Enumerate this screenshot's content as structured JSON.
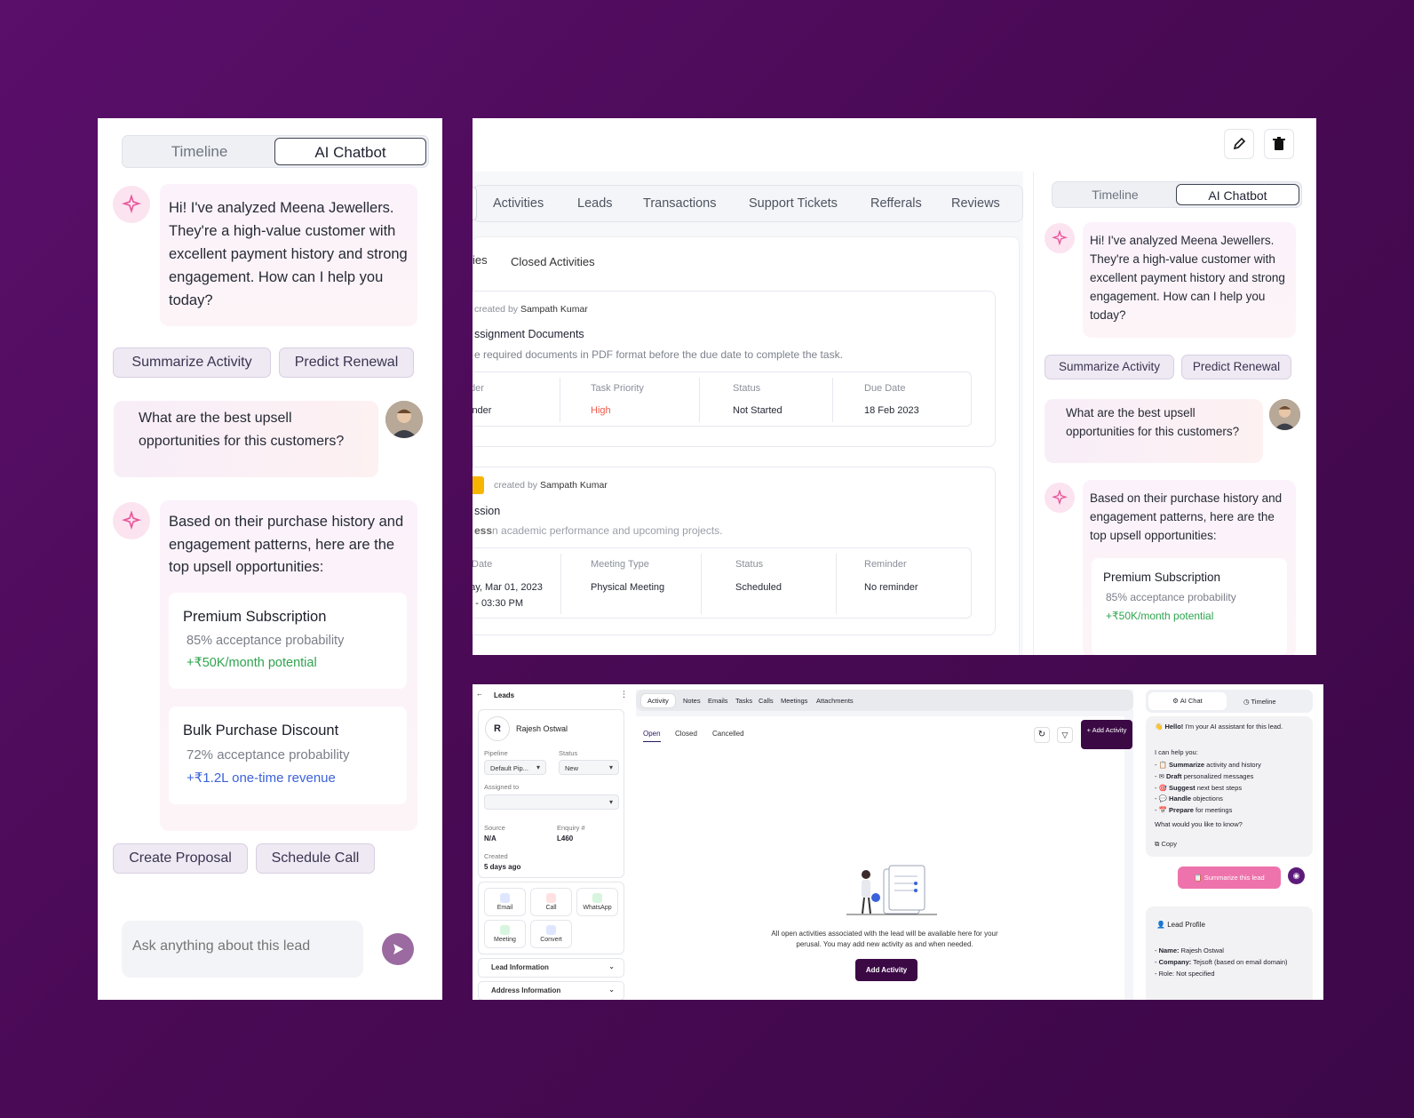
{
  "colors": {
    "background": "#4d0b5a",
    "accent_pink": "#e8559a",
    "accent_purple": "#3b0a45",
    "green": "#2ea44f",
    "blue": "#3b62d9",
    "high_red": "#f05a4b"
  },
  "chatbot": {
    "tabs": {
      "timeline": "Timeline",
      "ai_chatbot": "AI Chatbot"
    },
    "greeting": "Hi! I've analyzed Meena Jewellers. They're a high-value customer with excellent payment history and strong engagement. How can I help you today?",
    "suggestions": [
      "Summarize Activity",
      "Predict Renewal"
    ],
    "user_question": "What are the best upsell opportunities for this customers?",
    "answer_intro": "Based on their purchase history and engagement patterns, here are the top upsell opportunities:",
    "opportunities": [
      {
        "title": "Premium Subscription",
        "probability": "85% acceptance probability",
        "value": "+₹50K/month potential"
      },
      {
        "title": "Bulk Purchase Discount",
        "probability": "72% acceptance probability",
        "value": "+₹1.2L one-time revenue"
      }
    ],
    "actions": [
      "Create Proposal",
      "Schedule Call"
    ],
    "input_placeholder": "Ask anything about this lead"
  },
  "detail": {
    "tabs": [
      "Activities",
      "Leads",
      "Transactions",
      "Support Tickets",
      "Refferals",
      "Reviews"
    ],
    "subtabs": {
      "open_partial": "ies",
      "closed": "Closed Activities"
    },
    "activity1": {
      "created_by_prefix": "created by",
      "created_by": "Sampath Kumar",
      "title": "ssignment Documents",
      "desc": "e required documents in PDF format before the due date to complete the task.",
      "labels": [
        "der",
        "Task Priority",
        "Status",
        "Due Date"
      ],
      "values": [
        "inder",
        "High",
        "Not Started",
        "18 Feb 2023"
      ]
    },
    "activity2": {
      "created_by_prefix": "created by",
      "created_by": "Sampath Kumar",
      "title": "ssion",
      "desc_prefix": "ess",
      "desc": "n academic performance and upcoming projects.",
      "labels": [
        "Date",
        "Meeting Type",
        "Status",
        "Reminder"
      ],
      "values": [
        "day, Mar 01, 2023",
        "Physical Meeting",
        "Scheduled",
        "No reminder"
      ],
      "time": "M - 03:30 PM"
    }
  },
  "leads": {
    "back_label": "Leads",
    "lead": {
      "initial": "R",
      "name": "Rajesh Ostwal"
    },
    "pipeline": {
      "label": "Pipeline",
      "value": "Default Pip..."
    },
    "status": {
      "label": "Status",
      "value": "New"
    },
    "assigned": {
      "label": "Assigned to",
      "value": ""
    },
    "source": {
      "label": "Source",
      "value": "N/A"
    },
    "enquiry": {
      "label": "Enquiry #",
      "value": "L460"
    },
    "created": {
      "label": "Created",
      "value": "5 days ago"
    },
    "quick_actions": [
      "Email",
      "Call",
      "WhatsApp",
      "Meeting",
      "Convert"
    ],
    "sections": [
      "Lead Information",
      "Address Information"
    ],
    "top_tabs": [
      "Activity",
      "Notes",
      "Emails",
      "Tasks",
      "Calls",
      "Meetings",
      "Attachments"
    ],
    "activity_tabs": [
      "Open",
      "Closed",
      "Cancelled"
    ],
    "add_activity_top": "+ Add Activity",
    "empty_text": "All open activities associated with the lead will be available here for your perusal. You may add new activity as and when needed.",
    "add_activity_btn": "Add Activity",
    "ai": {
      "tabs": [
        "AI Chat",
        "Timeline"
      ],
      "hello_bold": "Hello!",
      "hello_rest": " I'm your AI assistant for this lead.",
      "can_help": "I can help you:",
      "items": [
        {
          "icon": "📋",
          "bold": "Summarize",
          "rest": " activity and history"
        },
        {
          "icon": "✉",
          "bold": "Draft",
          "rest": " personalized messages"
        },
        {
          "icon": "🎯",
          "bold": "Suggest",
          "rest": " next best steps"
        },
        {
          "icon": "💬",
          "bold": "Handle",
          "rest": " objections"
        },
        {
          "icon": "📅",
          "bold": "Prepare",
          "rest": " for meetings"
        }
      ],
      "question": "What would you like to know?",
      "copy": "Copy",
      "summarize_btn": "Summarize this lead",
      "profile_title": "Lead Profile",
      "profile_name_label": "Name:",
      "profile_name": " Rajesh Ostwal",
      "profile_company_label": "Company:",
      "profile_company": " Tejsoft (based on email domain)",
      "profile_role": "- Role: Not specified"
    }
  }
}
